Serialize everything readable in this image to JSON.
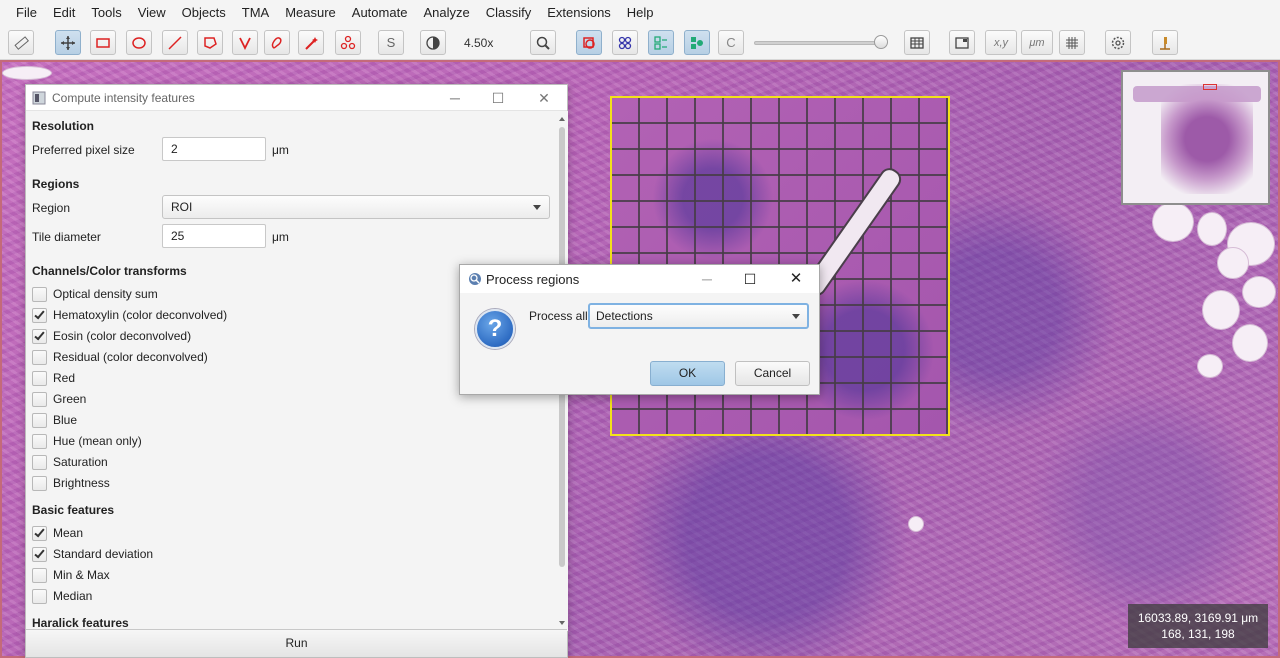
{
  "menu": [
    "File",
    "Edit",
    "Tools",
    "View",
    "Objects",
    "TMA",
    "Measure",
    "Automate",
    "Analyze",
    "Classify",
    "Extensions",
    "Help"
  ],
  "toolbar": {
    "zoom": "4.50x",
    "s_label": "S",
    "c_label": "C",
    "xy_label": "x,y",
    "um_label": "μm"
  },
  "intensity_dialog": {
    "title": "Compute intensity features",
    "resolution": {
      "heading": "Resolution",
      "pixel_size_label": "Preferred pixel size",
      "pixel_size_value": "2",
      "pixel_size_unit": "μm"
    },
    "regions": {
      "heading": "Regions",
      "region_label": "Region",
      "region_value": "ROI",
      "tile_label": "Tile diameter",
      "tile_value": "25",
      "tile_unit": "μm"
    },
    "channels": {
      "heading": "Channels/Color transforms",
      "items": [
        {
          "label": "Optical density sum",
          "checked": false
        },
        {
          "label": "Hematoxylin (color deconvolved)",
          "checked": true
        },
        {
          "label": "Eosin (color deconvolved)",
          "checked": true
        },
        {
          "label": "Residual (color deconvolved)",
          "checked": false
        },
        {
          "label": "Red",
          "checked": false
        },
        {
          "label": "Green",
          "checked": false
        },
        {
          "label": "Blue",
          "checked": false
        },
        {
          "label": "Hue (mean only)",
          "checked": false
        },
        {
          "label": "Saturation",
          "checked": false
        },
        {
          "label": "Brightness",
          "checked": false
        }
      ]
    },
    "basic": {
      "heading": "Basic features",
      "items": [
        {
          "label": "Mean",
          "checked": true
        },
        {
          "label": "Standard deviation",
          "checked": true
        },
        {
          "label": "Min & Max",
          "checked": false
        },
        {
          "label": "Median",
          "checked": false
        }
      ]
    },
    "haralick": {
      "heading": "Haralick features"
    },
    "run_label": "Run"
  },
  "process_dialog": {
    "title": "Process regions",
    "process_all_label": "Process all",
    "selected": "Detections",
    "ok_label": "OK",
    "cancel_label": "Cancel"
  },
  "status": {
    "coords": "16033.89, 3169.91 μm",
    "rgb": "168, 131, 198"
  }
}
